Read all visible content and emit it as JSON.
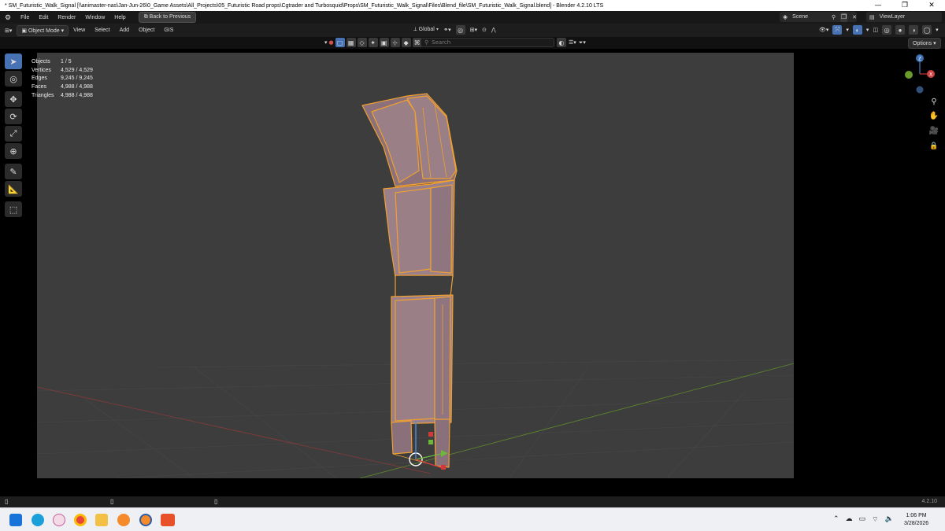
{
  "window": {
    "title": "* SM_Futuristic_Walk_Signal [\\\\animaster-nas\\Jan-Jun-26\\0_Game Assets\\All_Projects\\05_Futuristic Road props\\Cgtrader and Turbosquid\\Props\\SM_Futuristic_Walk_Signal\\Files\\Blend_file\\SM_Futuristic_Walk_Signal.blend] - Blender 4.2.10 LTS",
    "minimize": "—",
    "maximize": "❐",
    "close": "✕"
  },
  "menubar": {
    "items": [
      "File",
      "Edit",
      "Render",
      "Window",
      "Help"
    ],
    "back_button": "Back to Previous",
    "scene_label": "Scene",
    "viewlayer_label": "ViewLayer"
  },
  "header": {
    "mode": "Object Mode",
    "menus": [
      "View",
      "Select",
      "Add",
      "Object",
      "GIS"
    ],
    "orientation": "Global"
  },
  "filter": {
    "search_placeholder": "Search"
  },
  "options_label": "Options",
  "stats": [
    {
      "label": "Objects",
      "value": "1 / 5"
    },
    {
      "label": "Vertices",
      "value": "4,529 / 4,529"
    },
    {
      "label": "Edges",
      "value": "9,245 / 9,245"
    },
    {
      "label": "Faces",
      "value": "4,988 / 4,988"
    },
    {
      "label": "Triangles",
      "value": "4,988 / 4,988"
    }
  ],
  "gizmo": {
    "z_label": "Z",
    "x_label": "X"
  },
  "statusbar": {
    "version": "4.2.10"
  },
  "taskbar": {
    "time": "1:06 PM",
    "date": "3/28/2026"
  },
  "colors": {
    "selection": "#f0a030",
    "active_tool": "#4772b3",
    "object_fill": "#9a7f86"
  }
}
